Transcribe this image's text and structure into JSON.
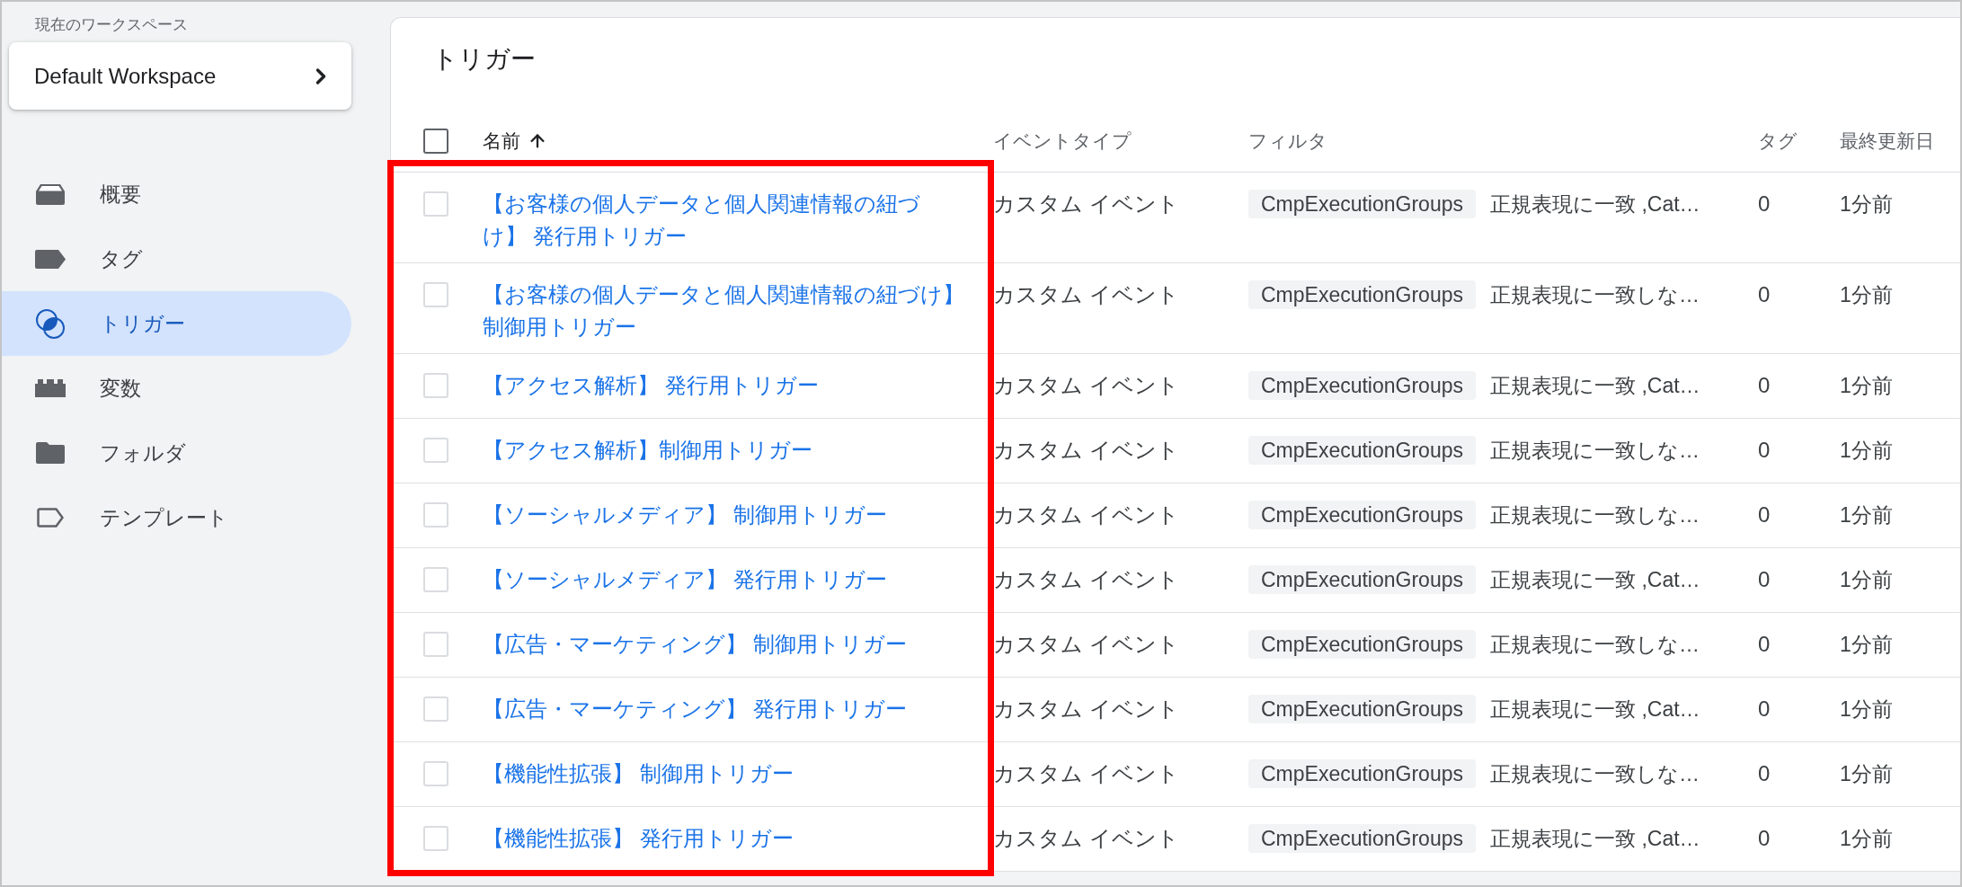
{
  "sidebar": {
    "workspace_label": "現在のワークスペース",
    "workspace": {
      "name": "Default Workspace"
    },
    "items": [
      {
        "label": "概要",
        "selected": false
      },
      {
        "label": "タグ",
        "selected": false
      },
      {
        "label": "トリガー",
        "selected": true
      },
      {
        "label": "変数",
        "selected": false
      },
      {
        "label": "フォルダ",
        "selected": false
      },
      {
        "label": "テンプレート",
        "selected": false
      }
    ]
  },
  "page": {
    "title": "トリガー"
  },
  "table": {
    "select_all": {
      "checked": false
    },
    "name_column_highlighted": true,
    "columns": [
      {
        "label": "名前",
        "sorted": true
      },
      {
        "label": "イベントタイプ",
        "sorted": false
      },
      {
        "label": "フィルタ",
        "sorted": false
      },
      {
        "label": "タグ",
        "sorted": false
      },
      {
        "label": "最終更新日",
        "sorted": false
      }
    ],
    "rows": [
      {
        "checked": false,
        "name": "【お客様の個人データと個人関連情報の紐づけ】 発行用トリガー",
        "event_type": "カスタム イベント",
        "filter_variable": "CmpExecutionGroups",
        "filter_condition": "正規表現に一致 ,Cat…",
        "tags": "0",
        "last_updated": "1分前"
      },
      {
        "checked": false,
        "name": "【お客様の個人データと個人関連情報の紐づけ】制御用トリガー",
        "event_type": "カスタム イベント",
        "filter_variable": "CmpExecutionGroups",
        "filter_condition": "正規表現に一致しな…",
        "tags": "0",
        "last_updated": "1分前"
      },
      {
        "checked": false,
        "name": "【アクセス解析】 発行用トリガー",
        "event_type": "カスタム イベント",
        "filter_variable": "CmpExecutionGroups",
        "filter_condition": "正規表現に一致 ,Cat…",
        "tags": "0",
        "last_updated": "1分前"
      },
      {
        "checked": false,
        "name": "【アクセス解析】制御用トリガー",
        "event_type": "カスタム イベント",
        "filter_variable": "CmpExecutionGroups",
        "filter_condition": "正規表現に一致しな…",
        "tags": "0",
        "last_updated": "1分前"
      },
      {
        "checked": false,
        "name": "【ソーシャルメディア】 制御用トリガー",
        "event_type": "カスタム イベント",
        "filter_variable": "CmpExecutionGroups",
        "filter_condition": "正規表現に一致しな…",
        "tags": "0",
        "last_updated": "1分前"
      },
      {
        "checked": false,
        "name": "【ソーシャルメディア】 発行用トリガー",
        "event_type": "カスタム イベント",
        "filter_variable": "CmpExecutionGroups",
        "filter_condition": "正規表現に一致 ,Cat…",
        "tags": "0",
        "last_updated": "1分前"
      },
      {
        "checked": false,
        "name": "【広告・マーケティング】 制御用トリガー",
        "event_type": "カスタム イベント",
        "filter_variable": "CmpExecutionGroups",
        "filter_condition": "正規表現に一致しな…",
        "tags": "0",
        "last_updated": "1分前"
      },
      {
        "checked": false,
        "name": "【広告・マーケティング】 発行用トリガー",
        "event_type": "カスタム イベント",
        "filter_variable": "CmpExecutionGroups",
        "filter_condition": "正規表現に一致 ,Cat…",
        "tags": "0",
        "last_updated": "1分前"
      },
      {
        "checked": false,
        "name": "【機能性拡張】 制御用トリガー",
        "event_type": "カスタム イベント",
        "filter_variable": "CmpExecutionGroups",
        "filter_condition": "正規表現に一致しな…",
        "tags": "0",
        "last_updated": "1分前"
      },
      {
        "checked": false,
        "name": "【機能性拡張】 発行用トリガー",
        "event_type": "カスタム イベント",
        "filter_variable": "CmpExecutionGroups",
        "filter_condition": "正規表現に一致 ,Cat…",
        "tags": "0",
        "last_updated": "1分前"
      }
    ]
  }
}
